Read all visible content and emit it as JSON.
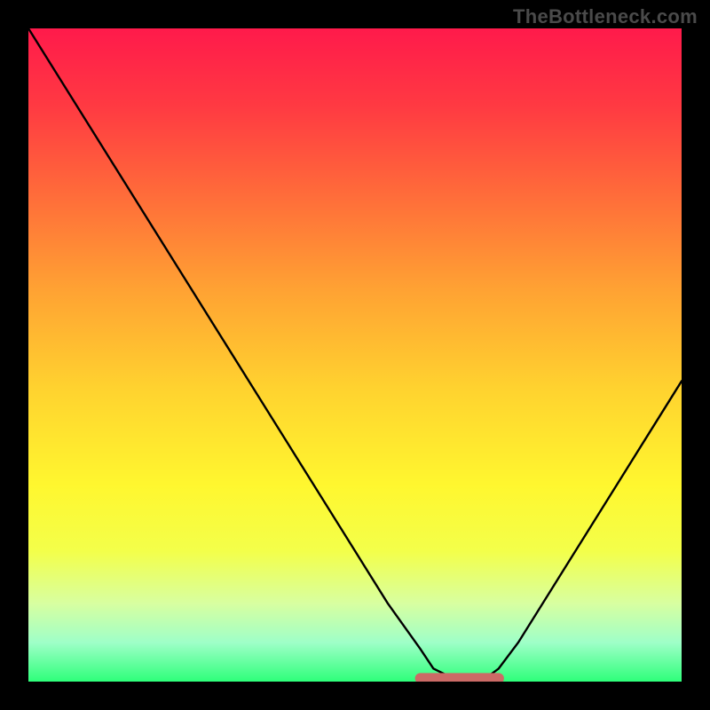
{
  "watermark": "TheBottleneck.com",
  "colors": {
    "frame": "#000000",
    "gradient_top": "#ff1a4b",
    "gradient_bottom": "#2eff7a",
    "curve": "#000000",
    "flat_marker": "#cc6a66"
  },
  "chart_data": {
    "type": "line",
    "title": "",
    "xlabel": "",
    "ylabel": "",
    "xlim": [
      0,
      100
    ],
    "ylim": [
      0,
      100
    ],
    "series": [
      {
        "name": "bottleneck-curve",
        "x": [
          0,
          5,
          10,
          15,
          20,
          25,
          30,
          35,
          40,
          45,
          50,
          55,
          60,
          62,
          65,
          70,
          72,
          75,
          80,
          85,
          90,
          95,
          100
        ],
        "values": [
          100,
          92,
          84,
          76,
          68,
          60,
          52,
          44,
          36,
          28,
          20,
          12,
          5,
          2,
          0.5,
          0.5,
          2,
          6,
          14,
          22,
          30,
          38,
          46
        ]
      }
    ],
    "annotations": [
      {
        "name": "flat-minimum-marker",
        "x_start": 60,
        "x_end": 72,
        "y": 0.5
      }
    ]
  }
}
